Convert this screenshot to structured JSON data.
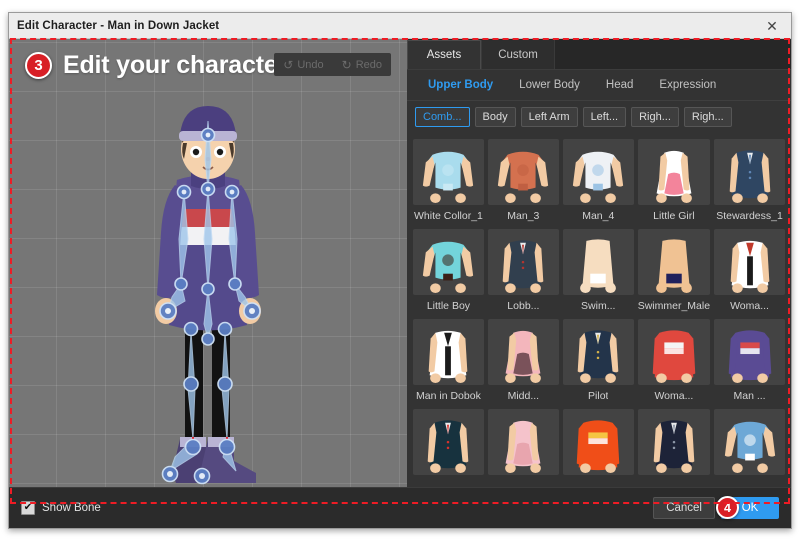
{
  "window": {
    "title": "Edit Character - Man in Down Jacket",
    "close_icon": "close-icon"
  },
  "preview": {
    "step_number": "3",
    "headline": "Edit your character",
    "undo": {
      "label": "Undo",
      "icon": "undo-arrow-icon"
    },
    "redo": {
      "label": "Redo",
      "icon": "redo-arrow-icon"
    },
    "character_name": "Man in Down Jacket"
  },
  "tabs": [
    {
      "label": "Assets",
      "active": true
    },
    {
      "label": "Custom",
      "active": false
    }
  ],
  "subtabs": [
    {
      "label": "Upper Body",
      "active": true
    },
    {
      "label": "Lower Body",
      "active": false
    },
    {
      "label": "Head",
      "active": false
    },
    {
      "label": "Expression",
      "active": false
    }
  ],
  "chips": [
    {
      "label": "Comb...",
      "active": true
    },
    {
      "label": "Body",
      "active": false
    },
    {
      "label": "Left Arm",
      "active": false
    },
    {
      "label": "Left...",
      "active": false
    },
    {
      "label": "Righ...",
      "active": false
    },
    {
      "label": "Righ...",
      "active": false
    }
  ],
  "assets": [
    {
      "label": "White Collor_1",
      "kind": "tee",
      "body": "#a9dced",
      "accent": "#c9e9f4",
      "skin": "#f2cba4"
    },
    {
      "label": "Man_3",
      "kind": "tee",
      "body": "#d4714f",
      "accent": "#c05f42",
      "skin": "#f2cba4"
    },
    {
      "label": "Man_4",
      "kind": "tee",
      "body": "#eef1f5",
      "accent": "#9cc3e4",
      "skin": "#f2cba4"
    },
    {
      "label": "Little Girl",
      "kind": "dress",
      "body": "#ffffff",
      "accent": "#f3849b",
      "skin": "#f2cba4"
    },
    {
      "label": "Stewardess_1",
      "kind": "suit",
      "body": "#2f4662",
      "accent": "#5f86b5",
      "skin": "#f2cba4"
    },
    {
      "label": "Little Boy",
      "kind": "tee",
      "body": "#73d4db",
      "accent": "#3a2018",
      "skin": "#f2cba4"
    },
    {
      "label": "Lobb...",
      "kind": "suit",
      "body": "#313f4e",
      "accent": "#b4352f",
      "skin": "#f2cba4"
    },
    {
      "label": "Swim...",
      "kind": "bare",
      "body": "#f6ddc0",
      "accent": "#ffffff",
      "skin": "#f6ddc0"
    },
    {
      "label": "Swimmer_Male",
      "kind": "bare",
      "body": "#f0c293",
      "accent": "#20215c",
      "skin": "#f0c293"
    },
    {
      "label": "Woma...",
      "kind": "dobok",
      "body": "#ffffff",
      "accent": "#c0392b",
      "skin": "#f2cba4"
    },
    {
      "label": "Man in Dobok",
      "kind": "dobok",
      "body": "#ffffff",
      "accent": "#1b1b1b",
      "skin": "#f2cba4"
    },
    {
      "label": "Midd...",
      "kind": "dress",
      "body": "#f3b6bc",
      "accent": "#7a525a",
      "skin": "#f2cba4"
    },
    {
      "label": "Pilot",
      "kind": "suit",
      "body": "#23344a",
      "accent": "#d4b14a",
      "skin": "#f2cba4"
    },
    {
      "label": "Woma...",
      "kind": "coat",
      "body": "#e0483e",
      "accent": "#f4f4f4",
      "skin": "#f2cba4"
    },
    {
      "label": "Man ...",
      "kind": "coat",
      "body": "#5a4b94",
      "accent": "#d84a4a",
      "skin": "#f2cba4"
    },
    {
      "label": "",
      "kind": "suit",
      "body": "#17323e",
      "accent": "#d6322c",
      "skin": "#f2cba4"
    },
    {
      "label": "",
      "kind": "dress",
      "body": "#f5c3cb",
      "accent": "#e8a5ae",
      "skin": "#f2cba4"
    },
    {
      "label": "",
      "kind": "coat",
      "body": "#f04e18",
      "accent": "#f5c542",
      "skin": "#f2cba4"
    },
    {
      "label": "",
      "kind": "suit",
      "body": "#1d2338",
      "accent": "#8d97a8",
      "skin": "#f2cba4"
    },
    {
      "label": "",
      "kind": "tee",
      "body": "#6da8d6",
      "accent": "#ffffff",
      "skin": "#f2cba4"
    }
  ],
  "footer": {
    "show_bone_label": "Show Bone",
    "show_bone_checked": true,
    "check_glyph": "✔",
    "cancel_label": "Cancel",
    "ok_label": "OK",
    "step_number": "4"
  },
  "colors": {
    "accent_blue": "#2f9bf0",
    "badge_red": "#d81f26",
    "highlight_red": "#ee1c25",
    "panel_bg": "#333333",
    "window_bg": "#2b2b2b",
    "stage_bg": "#767676",
    "titlebar_bg": "#ececec"
  }
}
